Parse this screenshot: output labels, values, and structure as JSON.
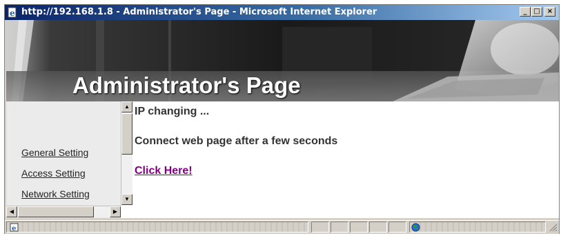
{
  "window": {
    "title": "http://192.168.1.8 - Administrator's Page - Microsoft Internet Explorer",
    "controls": {
      "minimize": "_",
      "maximize": "□",
      "close": "×"
    }
  },
  "banner": {
    "title": "Administrator's Page"
  },
  "sidebar": {
    "items": [
      {
        "label": "General Setting"
      },
      {
        "label": "Access Setting"
      },
      {
        "label": "Network Setting"
      }
    ]
  },
  "content": {
    "status_line": "IP changing ...",
    "message": "Connect web page after a few seconds",
    "link_label": "Click Here!"
  },
  "icons": {
    "title_icon": "ie-page-icon",
    "status_icon": "page-loaded-icon",
    "zone_icon": "internet-globe-icon"
  },
  "colors": {
    "link_visited": "#800080",
    "titlebar_start": "#0a246a",
    "titlebar_end": "#a6caf0"
  }
}
